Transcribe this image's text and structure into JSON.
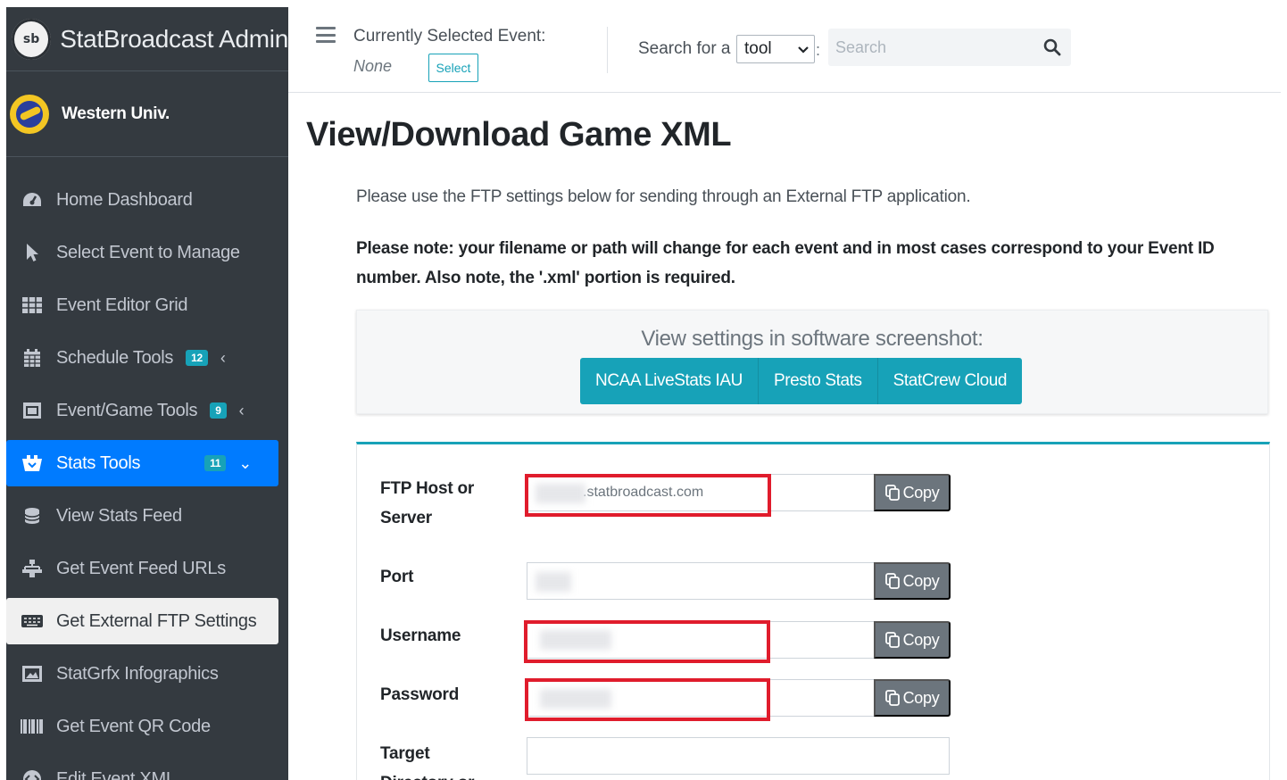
{
  "brand": {
    "logo_text": "sb",
    "title": "StatBroadcast Admin"
  },
  "user": {
    "name": "Western Univ."
  },
  "nav": [
    {
      "label": "Home Dashboard",
      "icon": "dashboard-icon"
    },
    {
      "label": "Select Event to Manage",
      "icon": "cursor-icon"
    },
    {
      "label": "Event Editor Grid",
      "icon": "grid-icon"
    },
    {
      "label": "Schedule Tools",
      "icon": "calendar-icon",
      "badge": "12"
    },
    {
      "label": "Event/Game Tools",
      "icon": "window-icon",
      "badge": "9"
    },
    {
      "label": "Stats Tools",
      "icon": "stats-icon",
      "badge": "11"
    },
    {
      "label": "View Stats Feed",
      "icon": "database-icon"
    },
    {
      "label": "Get Event Feed URLs",
      "icon": "sitemap-icon"
    },
    {
      "label": "Get External FTP Settings",
      "icon": "keyboard-icon"
    },
    {
      "label": "StatGrfx Infographics",
      "icon": "image-icon"
    },
    {
      "label": "Get Event QR Code",
      "icon": "barcode-icon"
    },
    {
      "label": "Edit Event XML",
      "icon": "code-icon"
    }
  ],
  "topbar": {
    "current_label": "Currently Selected Event:",
    "current_value": "None",
    "select_label": "Select",
    "search_for_label": "Search for a",
    "tool_select_value": "tool",
    "search_placeholder": "Search"
  },
  "page": {
    "title": "View/Download Game XML",
    "intro": "Please use the FTP settings below for sending through an External FTP application.",
    "note": "Please note: your filename or path will change for each event and in most cases correspond to your Event ID number. Also note, the '.xml' portion is required."
  },
  "screenshot_card": {
    "title": "View settings in software screenshot:",
    "buttons": [
      "NCAA LiveStats IAU",
      "Presto Stats",
      "StatCrew Cloud"
    ]
  },
  "ftp": {
    "host_label_line1": "FTP Host or",
    "host_label_line2": "Server",
    "host_value": ".statbroadcast.com",
    "port_label": "Port",
    "username_label": "Username",
    "password_label": "Password",
    "target_label_line1": "Target",
    "target_label_line2": "Directory or",
    "copy_label": "Copy"
  },
  "colors": {
    "sidebar_bg": "#343a40",
    "active_blue": "#007bff",
    "teal": "#17a2b8",
    "highlight_red": "#e01c2c",
    "copy_gray": "#6c757d"
  }
}
